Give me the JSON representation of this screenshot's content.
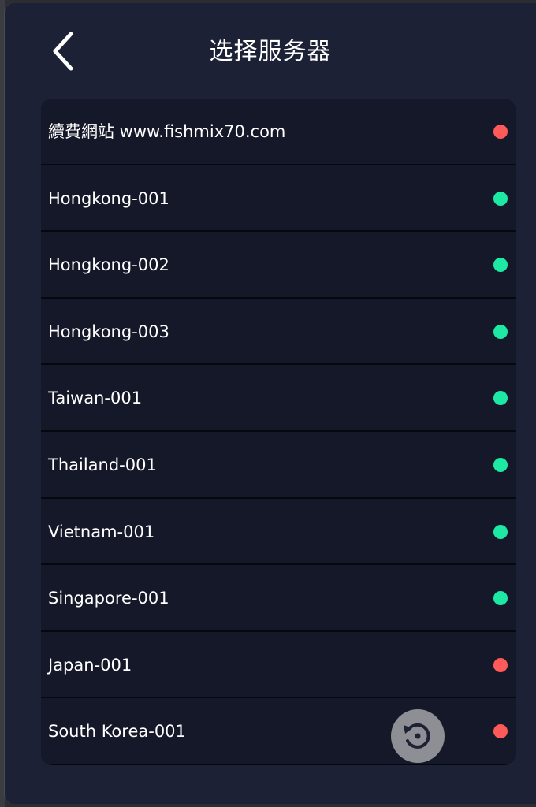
{
  "header": {
    "title": "选择服务器",
    "back_icon": "chevron-left-icon"
  },
  "colors": {
    "online": "#1de9a4",
    "offline": "#ff5a5a"
  },
  "servers": [
    {
      "name": "續費網站 www.fishmix70.com",
      "status": "offline"
    },
    {
      "name": "Hongkong-001",
      "status": "online"
    },
    {
      "name": "Hongkong-002",
      "status": "online"
    },
    {
      "name": "Hongkong-003",
      "status": "online"
    },
    {
      "name": "Taiwan-001",
      "status": "online"
    },
    {
      "name": "Thailand-001",
      "status": "online"
    },
    {
      "name": "Vietnam-001",
      "status": "online"
    },
    {
      "name": "Singapore-001",
      "status": "online"
    },
    {
      "name": "Japan-001",
      "status": "offline"
    },
    {
      "name": "South Korea-001",
      "status": "offline"
    }
  ],
  "refresh": {
    "icon": "refresh-icon"
  }
}
